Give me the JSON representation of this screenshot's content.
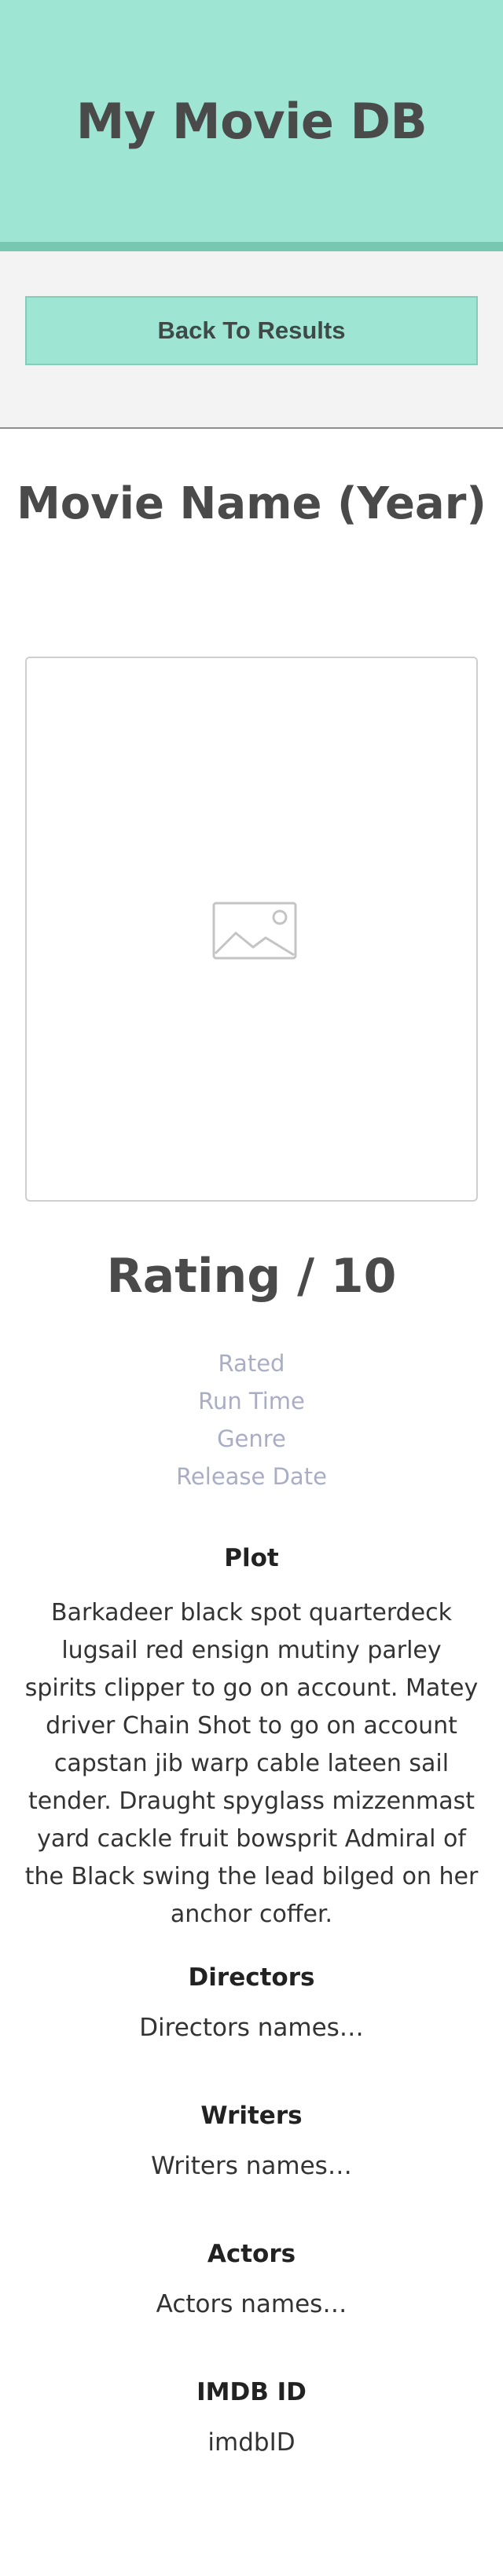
{
  "header": {
    "title": "My Movie DB"
  },
  "nav": {
    "back_label": "Back To Results"
  },
  "movie": {
    "title": "Movie Name (Year)",
    "poster_icon": "image-placeholder-icon",
    "rating": "Rating / 10",
    "rated": "Rated",
    "run_time": "Run Time",
    "genre": "Genre",
    "release_date": "Release Date"
  },
  "plot": {
    "heading": "Plot",
    "text": "Barkadeer black spot quarterdeck lugsail red ensign mutiny parley spirits clipper to go on account. Matey driver Chain Shot to go on account capstan jib warp cable lateen sail tender. Draught spyglass mizzenmast yard cackle fruit bowsprit Admiral of the Black swing the lead bilged on her anchor coffer."
  },
  "directors": {
    "heading": "Directors",
    "text": "Directors names…"
  },
  "writers": {
    "heading": "Writers",
    "text": "Writers names…"
  },
  "actors": {
    "heading": "Actors",
    "text": "Actors names…"
  },
  "imdb": {
    "heading": "IMDB ID",
    "text": "imdbID"
  },
  "colors": {
    "accent": "#9ee6d3",
    "accent_border": "#78c7b1",
    "meta_text": "#a9aec4"
  }
}
